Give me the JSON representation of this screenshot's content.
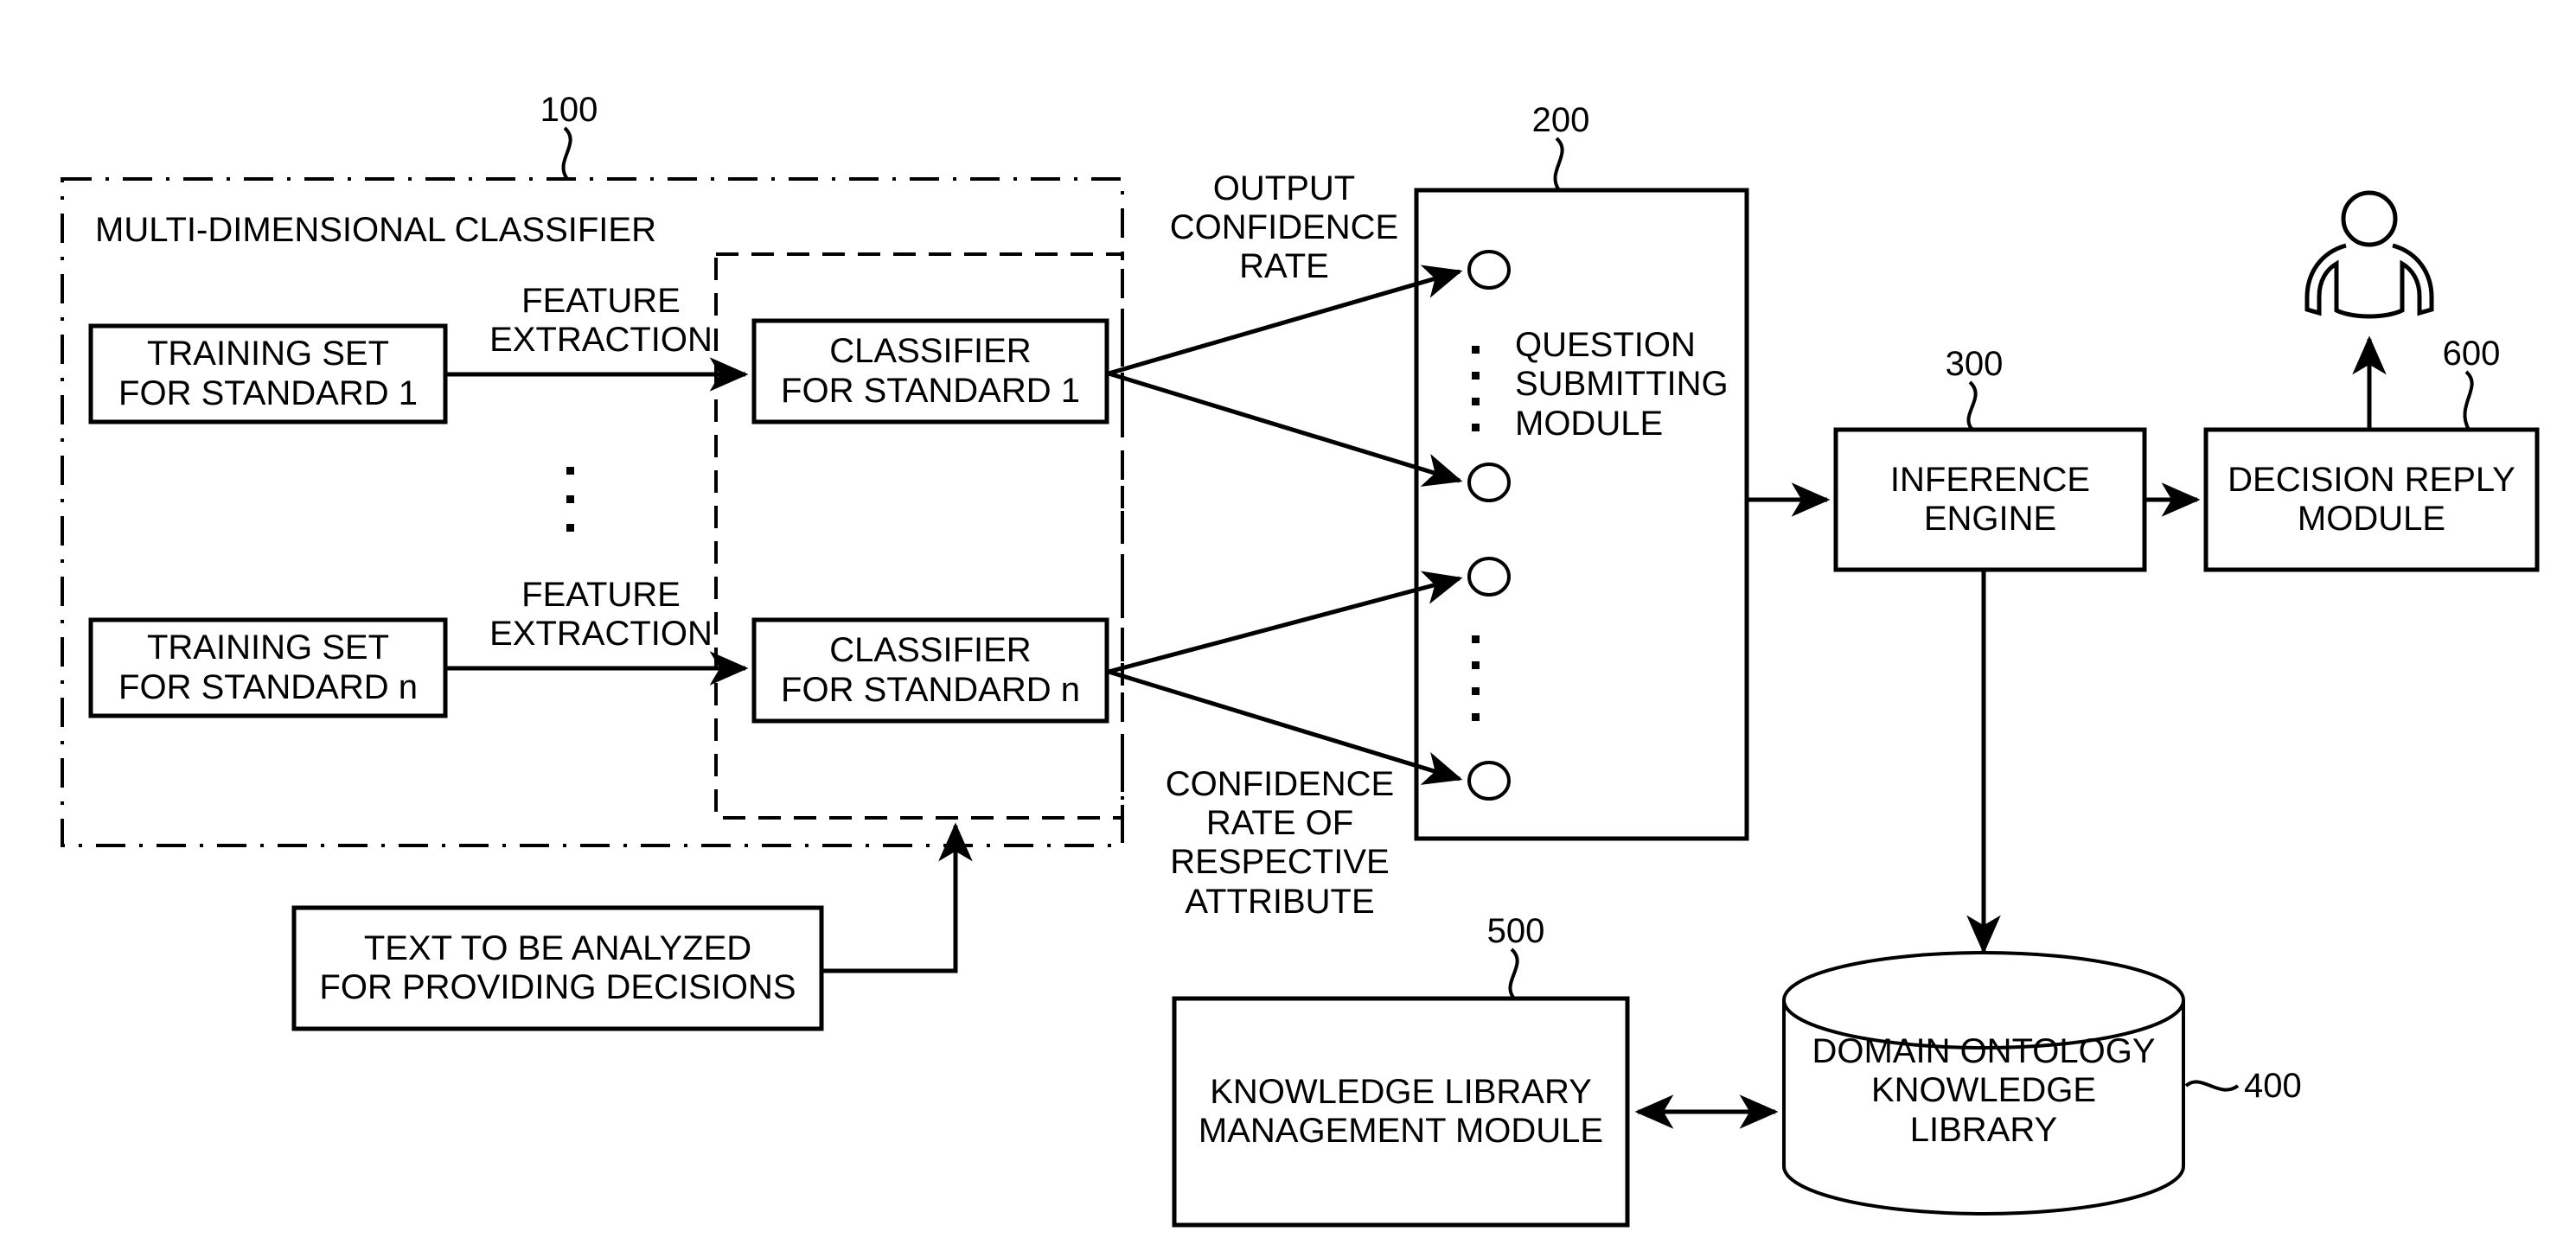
{
  "diagram": {
    "type": "patent-block-diagram",
    "background": "#ffffff",
    "stroke": "#000000"
  },
  "groups": {
    "multi_dimensional_classifier": {
      "title": "MULTI-DIMENSIONAL CLASSIFIER",
      "ref": "100",
      "border_style": "dash-dot"
    },
    "classifier_inner": {
      "border_style": "dashed"
    }
  },
  "boxes": {
    "training_set_1": "TRAINING SET\nFOR STANDARD 1",
    "training_set_n": "TRAINING SET\nFOR STANDARD n",
    "classifier_1": "CLASSIFIER\nFOR STANDARD 1",
    "classifier_n": "CLASSIFIER\nFOR STANDARD n",
    "question_submitting_module": "QUESTION\nSUBMITTING\nMODULE",
    "inference_engine": "INFERENCE\nENGINE",
    "decision_reply_module": "DECISION REPLY\nMODULE",
    "knowledge_library_management_module": "KNOWLEDGE LIBRARY\nMANAGEMENT MODULE",
    "text_to_be_analyzed": "TEXT TO BE ANALYZED\nFOR PROVIDING DECISIONS",
    "domain_ontology_knowledge_library": "DOMAIN ONTOLOGY\nKNOWLEDGE\nLIBRARY"
  },
  "edge_labels": {
    "feature_extraction_top": "FEATURE\nEXTRACTION",
    "feature_extraction_bottom": "FEATURE\nEXTRACTION",
    "output_confidence_rate": "OUTPUT\nCONFIDENCE\nRATE",
    "confidence_rate_of_respective_attribute": "CONFIDENCE\nRATE OF\nRESPECTIVE\nATTRIBUTE"
  },
  "reference_numerals": {
    "multi_dimensional_classifier": "100",
    "question_submitting_module": "200",
    "inference_engine": "300",
    "domain_ontology_knowledge_library": "400",
    "knowledge_library_management_module": "500",
    "decision_reply_module": "600"
  },
  "icons": {
    "user": "user-person-icon"
  },
  "ellipsis": {
    "training_column": "vertical-ellipsis",
    "classifier_column": "vertical-ellipsis",
    "module_ports_upper": "vertical-ellipsis",
    "module_ports_lower": "vertical-ellipsis"
  },
  "ports": {
    "count": 4,
    "shape": "circle"
  }
}
